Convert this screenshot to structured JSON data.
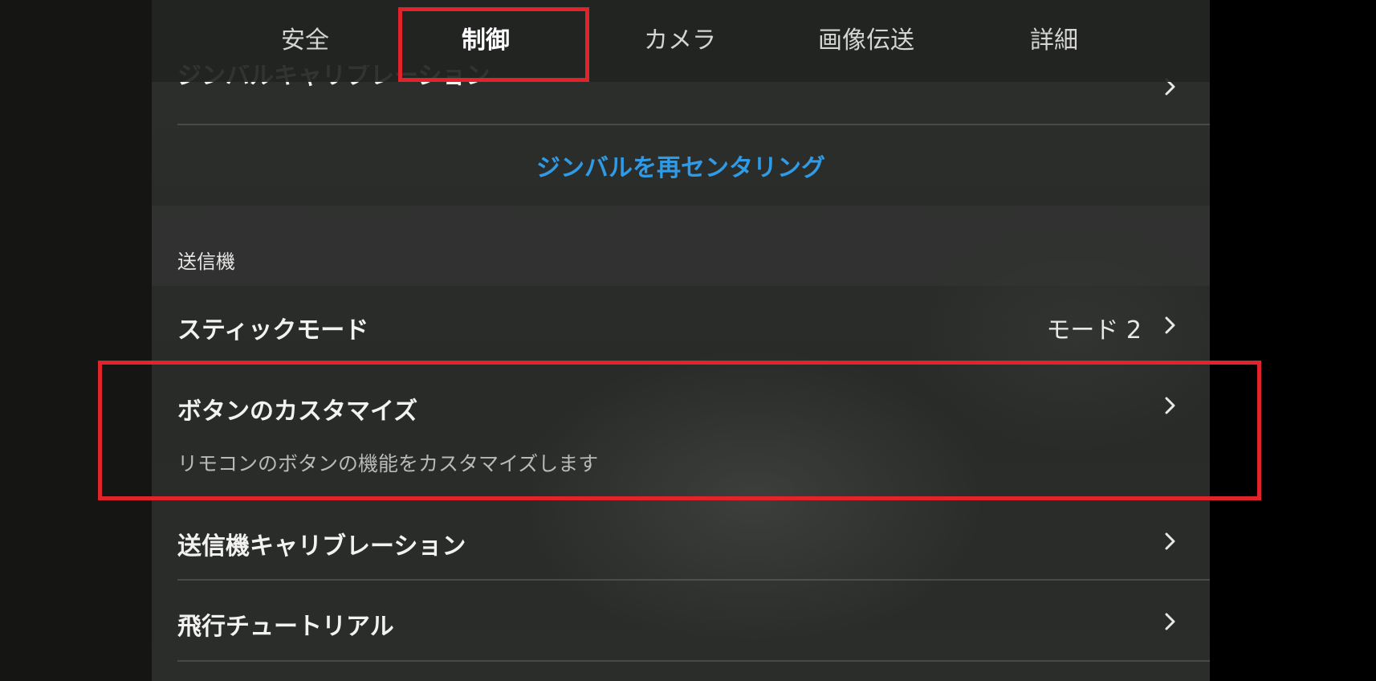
{
  "tabs": [
    {
      "label": "安全",
      "active": false
    },
    {
      "label": "制御",
      "active": true
    },
    {
      "label": "カメラ",
      "active": false
    },
    {
      "label": "画像伝送",
      "active": false
    },
    {
      "label": "詳細",
      "active": false
    }
  ],
  "gimbal": {
    "calibration_label": "ジンバルキャリブレーション",
    "recenter_label": "ジンバルを再センタリング"
  },
  "transmitter": {
    "section_label": "送信機",
    "stick_mode": {
      "label": "スティックモード",
      "value": "モード 2"
    },
    "button_customize": {
      "label": "ボタンのカスタマイズ",
      "description": "リモコンのボタンの機能をカスタマイズします"
    },
    "calibration": {
      "label": "送信機キャリブレーション"
    },
    "tutorial": {
      "label": "飛行チュートリアル"
    }
  },
  "icons": {
    "chevron": "chevron-right-icon"
  },
  "colors": {
    "accent_blue": "#2f9be6",
    "highlight_red": "#e1232b",
    "panel_bg": "#2b2d2b"
  }
}
